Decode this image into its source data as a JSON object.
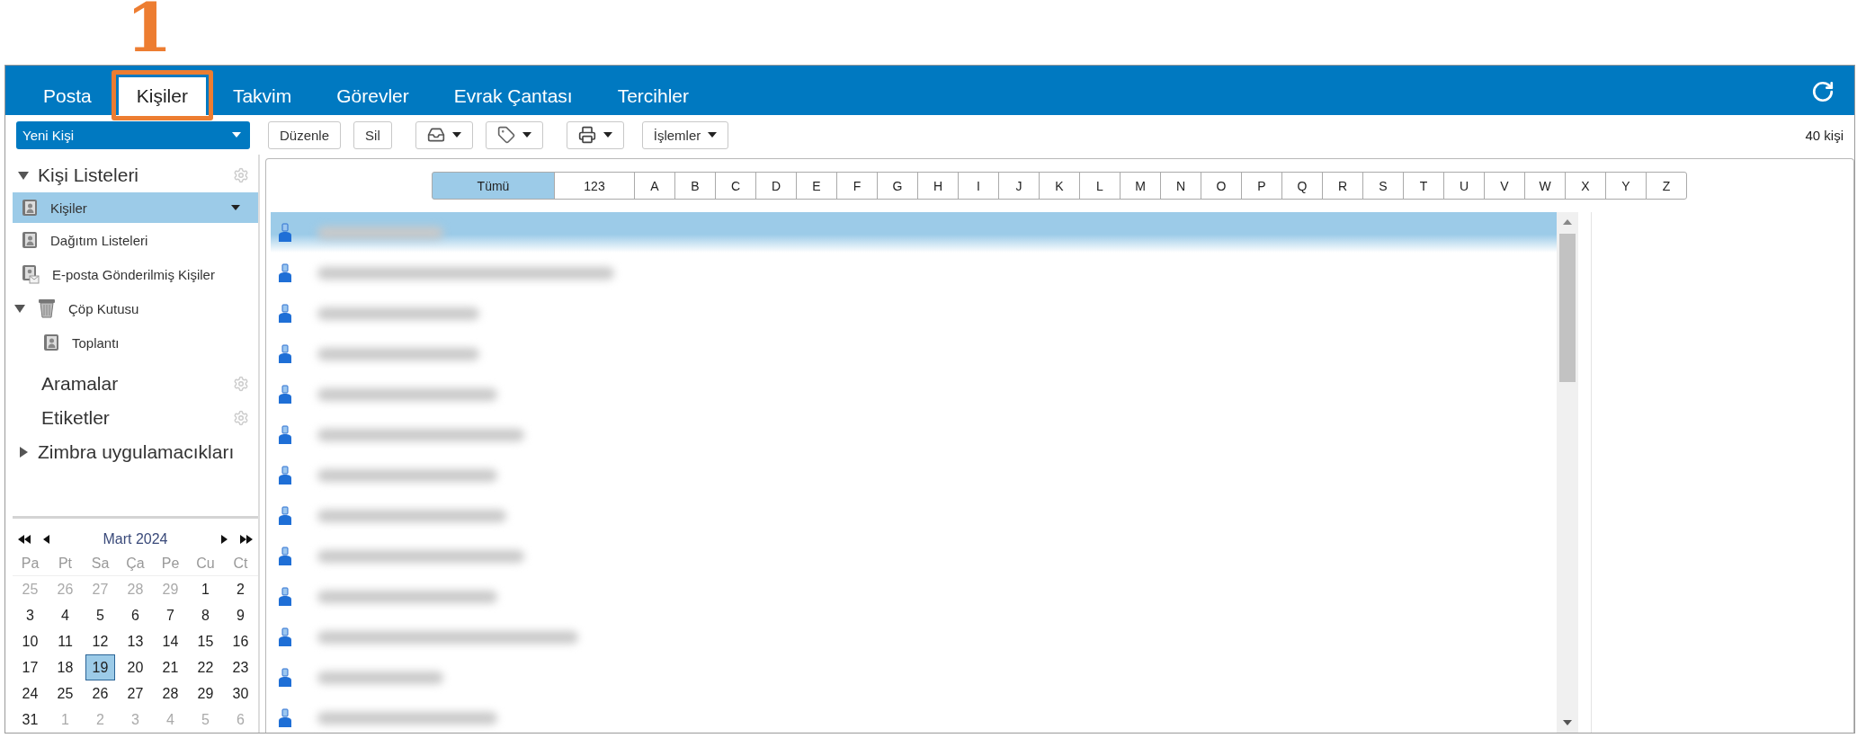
{
  "annotation": {
    "label": "1"
  },
  "tabs": [
    {
      "label": "Posta",
      "selected": false,
      "highlighted": false
    },
    {
      "label": "Kişiler",
      "selected": true,
      "highlighted": true
    },
    {
      "label": "Takvim",
      "selected": false,
      "highlighted": false
    },
    {
      "label": "Görevler",
      "selected": false,
      "highlighted": false
    },
    {
      "label": "Evrak Çantası",
      "selected": false,
      "highlighted": false
    },
    {
      "label": "Tercihler",
      "selected": false,
      "highlighted": false
    }
  ],
  "toolbar": {
    "new_button": "Yeni Kişi",
    "buttons": [
      {
        "kind": "text",
        "label": "Düzenle"
      },
      {
        "kind": "text",
        "label": "Sil"
      },
      {
        "kind": "tray-menu"
      },
      {
        "kind": "tag-menu"
      },
      {
        "kind": "printer-menu"
      },
      {
        "kind": "menu",
        "label": "İşlemler"
      }
    ],
    "count": "40 kişi"
  },
  "sidebar": {
    "sections": [
      {
        "title": "Kişi Listeleri",
        "expanded": true,
        "gear": true,
        "items": [
          {
            "label": "Kişiler",
            "kind": "contacts",
            "selected": true
          },
          {
            "label": "Dağıtım Listeleri",
            "kind": "contacts",
            "selected": false
          },
          {
            "label": "E-posta Gönderilmiş Kişiler",
            "kind": "emailed",
            "selected": false
          },
          {
            "label": "Çöp Kutusu",
            "kind": "trash",
            "selected": false,
            "expanded": true,
            "children": [
              {
                "label": "Toplantı",
                "kind": "contacts",
                "selected": false
              }
            ]
          }
        ]
      },
      {
        "title": "Aramalar",
        "gear": true
      },
      {
        "title": "Etiketler",
        "gear": true
      },
      {
        "title": "Zimbra uygulamacıkları",
        "expanded": false,
        "gear": false
      }
    ]
  },
  "calendar": {
    "title": "Mart 2024",
    "weekdays": [
      "Pa",
      "Pt",
      "Sa",
      "Ça",
      "Pe",
      "Cu",
      "Ct"
    ],
    "weeks": [
      [
        {
          "day": "25",
          "other_month": true,
          "selected": false
        },
        {
          "day": "26",
          "other_month": true,
          "selected": false
        },
        {
          "day": "27",
          "other_month": true,
          "selected": false
        },
        {
          "day": "28",
          "other_month": true,
          "selected": false
        },
        {
          "day": "29",
          "other_month": true,
          "selected": false
        },
        {
          "day": "1",
          "other_month": false,
          "selected": false
        },
        {
          "day": "2",
          "other_month": false,
          "selected": false
        }
      ],
      [
        {
          "day": "3",
          "other_month": false,
          "selected": false
        },
        {
          "day": "4",
          "other_month": false,
          "selected": false
        },
        {
          "day": "5",
          "other_month": false,
          "selected": false
        },
        {
          "day": "6",
          "other_month": false,
          "selected": false
        },
        {
          "day": "7",
          "other_month": false,
          "selected": false
        },
        {
          "day": "8",
          "other_month": false,
          "selected": false
        },
        {
          "day": "9",
          "other_month": false,
          "selected": false
        }
      ],
      [
        {
          "day": "10",
          "other_month": false,
          "selected": false
        },
        {
          "day": "11",
          "other_month": false,
          "selected": false
        },
        {
          "day": "12",
          "other_month": false,
          "selected": false
        },
        {
          "day": "13",
          "other_month": false,
          "selected": false
        },
        {
          "day": "14",
          "other_month": false,
          "selected": false
        },
        {
          "day": "15",
          "other_month": false,
          "selected": false
        },
        {
          "day": "16",
          "other_month": false,
          "selected": false
        }
      ],
      [
        {
          "day": "17",
          "other_month": false,
          "selected": false
        },
        {
          "day": "18",
          "other_month": false,
          "selected": false
        },
        {
          "day": "19",
          "other_month": false,
          "selected": true
        },
        {
          "day": "20",
          "other_month": false,
          "selected": false
        },
        {
          "day": "21",
          "other_month": false,
          "selected": false
        },
        {
          "day": "22",
          "other_month": false,
          "selected": false
        },
        {
          "day": "23",
          "other_month": false,
          "selected": false
        }
      ],
      [
        {
          "day": "24",
          "other_month": false,
          "selected": false
        },
        {
          "day": "25",
          "other_month": false,
          "selected": false
        },
        {
          "day": "26",
          "other_month": false,
          "selected": false
        },
        {
          "day": "27",
          "other_month": false,
          "selected": false
        },
        {
          "day": "28",
          "other_month": false,
          "selected": false
        },
        {
          "day": "29",
          "other_month": false,
          "selected": false
        },
        {
          "day": "30",
          "other_month": false,
          "selected": false
        }
      ],
      [
        {
          "day": "31",
          "other_month": false,
          "selected": false
        },
        {
          "day": "1",
          "other_month": true,
          "selected": false
        },
        {
          "day": "2",
          "other_month": true,
          "selected": false
        },
        {
          "day": "3",
          "other_month": true,
          "selected": false
        },
        {
          "day": "4",
          "other_month": true,
          "selected": false
        },
        {
          "day": "5",
          "other_month": true,
          "selected": false
        },
        {
          "day": "6",
          "other_month": true,
          "selected": false
        }
      ]
    ]
  },
  "alphabet": [
    {
      "label": "Tümü",
      "selected": true
    },
    {
      "label": "123",
      "selected": false
    },
    {
      "label": "A",
      "selected": false
    },
    {
      "label": "B",
      "selected": false
    },
    {
      "label": "C",
      "selected": false
    },
    {
      "label": "D",
      "selected": false
    },
    {
      "label": "E",
      "selected": false
    },
    {
      "label": "F",
      "selected": false
    },
    {
      "label": "G",
      "selected": false
    },
    {
      "label": "H",
      "selected": false
    },
    {
      "label": "I",
      "selected": false
    },
    {
      "label": "J",
      "selected": false
    },
    {
      "label": "K",
      "selected": false
    },
    {
      "label": "L",
      "selected": false
    },
    {
      "label": "M",
      "selected": false
    },
    {
      "label": "N",
      "selected": false
    },
    {
      "label": "O",
      "selected": false
    },
    {
      "label": "P",
      "selected": false
    },
    {
      "label": "Q",
      "selected": false
    },
    {
      "label": "R",
      "selected": false
    },
    {
      "label": "S",
      "selected": false
    },
    {
      "label": "T",
      "selected": false
    },
    {
      "label": "U",
      "selected": false
    },
    {
      "label": "V",
      "selected": false
    },
    {
      "label": "W",
      "selected": false
    },
    {
      "label": "X",
      "selected": false
    },
    {
      "label": "Y",
      "selected": false
    },
    {
      "label": "Z",
      "selected": false
    }
  ],
  "contacts": [
    {
      "selected": true
    },
    {
      "selected": false
    },
    {
      "selected": false
    },
    {
      "selected": false
    },
    {
      "selected": false
    },
    {
      "selected": false
    },
    {
      "selected": false
    },
    {
      "selected": false
    },
    {
      "selected": false
    },
    {
      "selected": false
    },
    {
      "selected": false
    },
    {
      "selected": false
    },
    {
      "selected": false
    }
  ]
}
